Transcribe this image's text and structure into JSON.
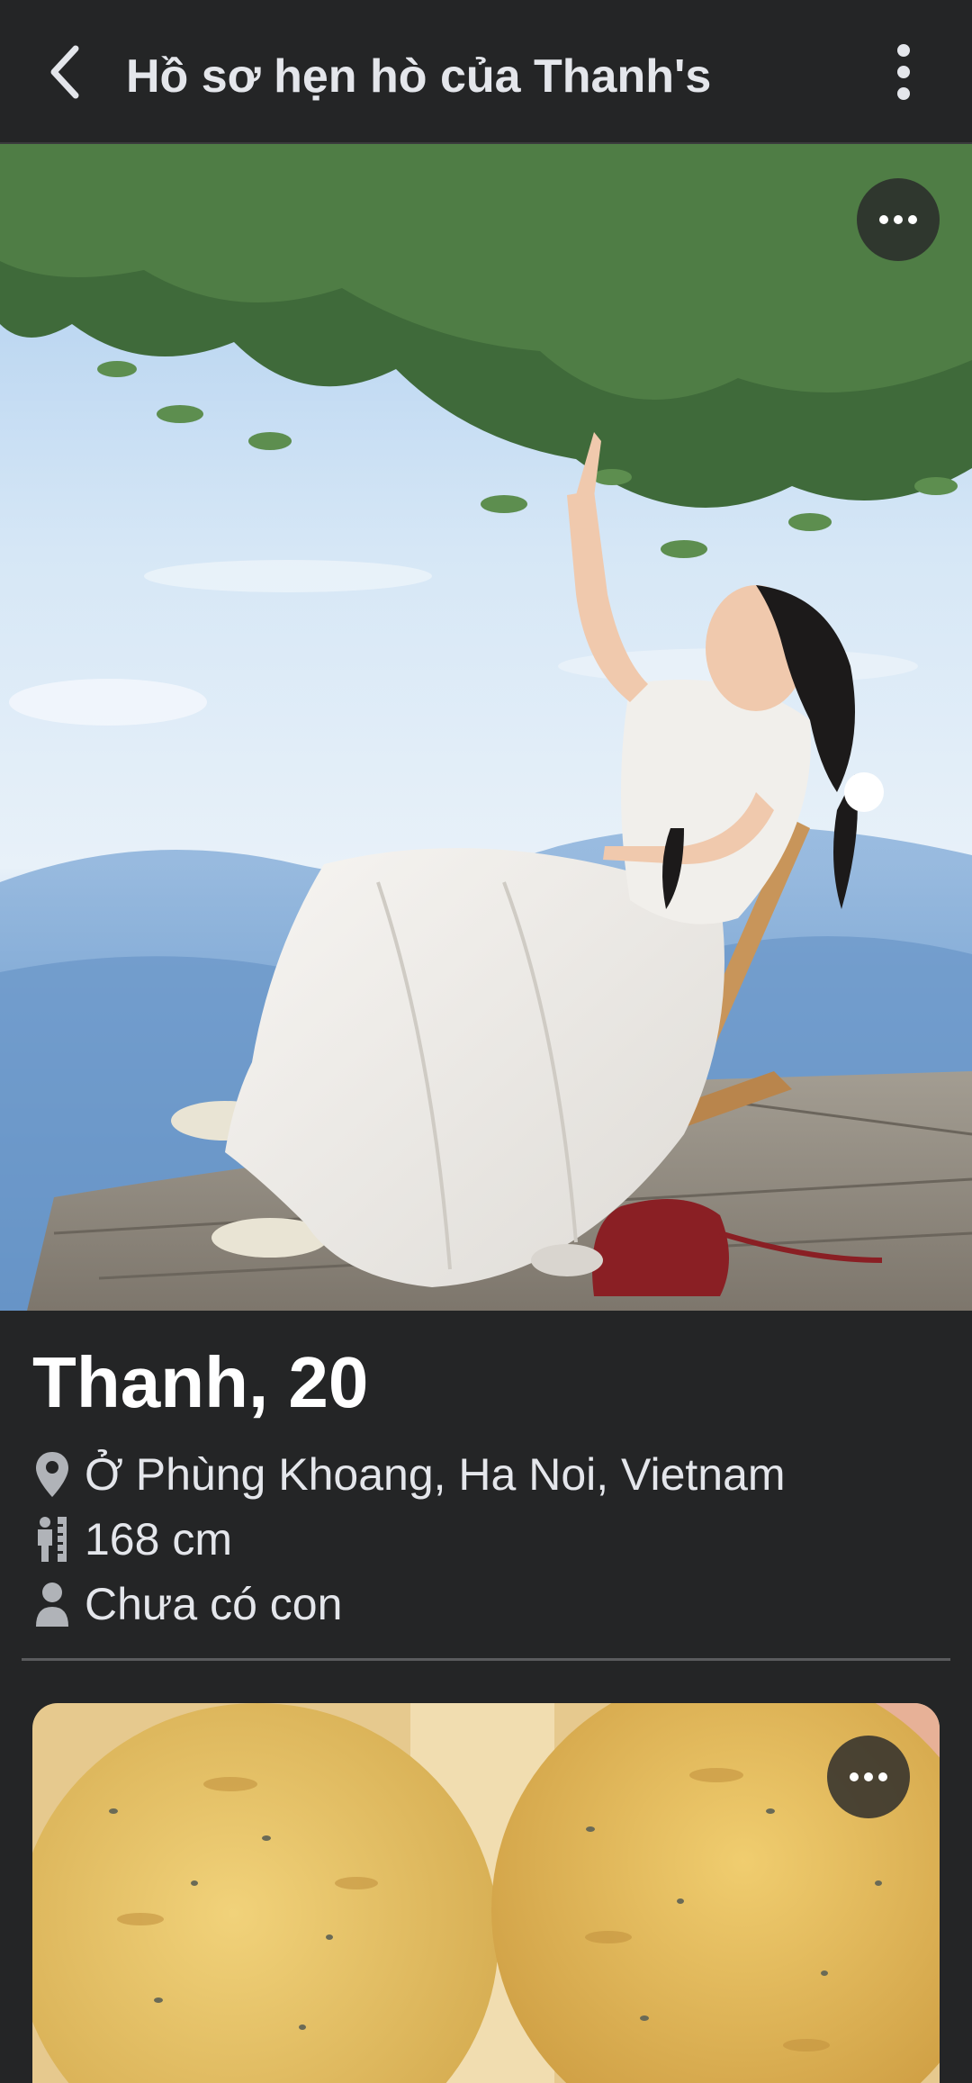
{
  "header": {
    "title": "Hồ sơ hẹn hò của Thanh's",
    "back_icon": "chevron-left-icon",
    "menu_icon": "vertical-ellipsis-icon"
  },
  "photos": [
    {
      "description_icon": "more-horizontal-icon"
    },
    {
      "description_icon": "more-horizontal-icon"
    }
  ],
  "profile": {
    "name_age": "Thanh, 20",
    "location": "Ở Phùng Khoang, Ha Noi, Vietnam",
    "height": "168 cm",
    "children": "Chưa có con"
  },
  "colors": {
    "background": "#242526",
    "text_primary": "#ffffff",
    "text_secondary": "#e4e6eb",
    "icon_gray": "#b0b3b8",
    "divider": "#5a5b5d"
  }
}
